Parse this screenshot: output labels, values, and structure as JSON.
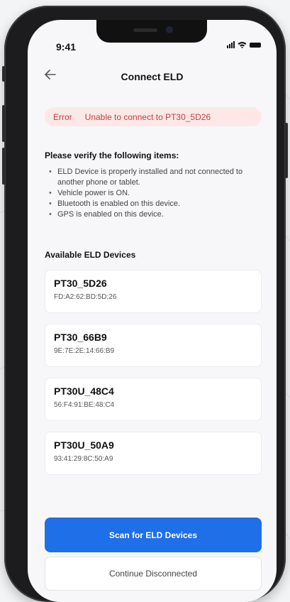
{
  "status_bar": {
    "time": "9:41"
  },
  "header": {
    "title": "Connect ELD",
    "back_icon": "arrow-left-icon"
  },
  "error": {
    "tag": "Error",
    "message": "Unable to connect to PT30_5D26",
    "color": "#c43d3d"
  },
  "verify": {
    "title": "Please verify the following items:",
    "items": [
      "ELD Device is properly installed and not connected to another phone or tablet.",
      "Vehicle power is ON.",
      "Bluetooth is enabled on this device.",
      "GPS is enabled on this device."
    ]
  },
  "available": {
    "title": "Available ELD Devices",
    "devices": [
      {
        "name": "PT30_5D26",
        "mac": "FD:A2:62:BD:5D:26"
      },
      {
        "name": "PT30_66B9",
        "mac": "9E:7E:2E:14:66:B9"
      },
      {
        "name": "PT30U_48C4",
        "mac": "56:F4:91:BE:48:C4"
      },
      {
        "name": "PT30U_50A9",
        "mac": "93:41:29:8C:50:A9"
      }
    ]
  },
  "actions": {
    "scan_label": "Scan for ELD Devices",
    "continue_label": "Continue Disconnected",
    "accent": "#1f6fe8"
  }
}
